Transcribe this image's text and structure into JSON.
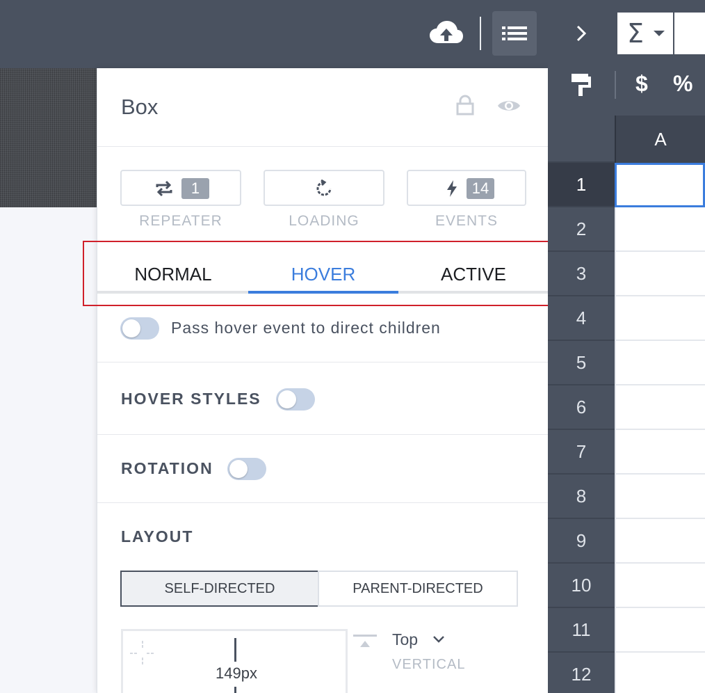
{
  "panel": {
    "title": "Box",
    "tools": {
      "repeater": {
        "label": "REPEATER",
        "count": "1"
      },
      "loading": {
        "label": "LOADING"
      },
      "events": {
        "label": "EVENTS",
        "count": "14"
      }
    },
    "tabs": [
      {
        "label": "NORMAL"
      },
      {
        "label": "HOVER",
        "active": true
      },
      {
        "label": "ACTIVE"
      }
    ],
    "pass_hover_label": "Pass hover event to direct children",
    "hover_styles_label": "HOVER STYLES",
    "rotation_label": "ROTATION",
    "layout": {
      "title": "LAYOUT",
      "self_directed": "SELF-DIRECTED",
      "parent_directed": "PARENT-DIRECTED",
      "position_value": "149px",
      "vertical_value": "Top",
      "vertical_label": "VERTICAL"
    }
  },
  "sheet": {
    "column_header": "A",
    "format_currency": "$",
    "format_percent": "%",
    "sigma": "Σ",
    "rows": [
      "1",
      "2",
      "3",
      "4",
      "5",
      "6",
      "7",
      "8",
      "9",
      "10",
      "11",
      "12"
    ]
  },
  "colors": {
    "accent": "#3b7ddd",
    "highlight_outline": "#d0202a",
    "topbar": "#4a5260"
  }
}
